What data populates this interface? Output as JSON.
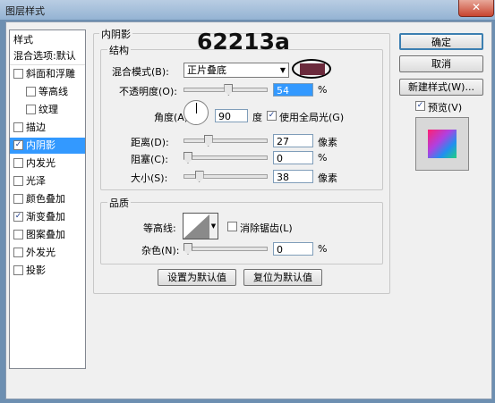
{
  "window": {
    "title": "图层样式",
    "close_glyph": "✕"
  },
  "overlay": {
    "watermark": "62213a"
  },
  "style_list": {
    "header": "样式",
    "blend_default": "混合选项:默认",
    "items": [
      {
        "label": "斜面和浮雕",
        "checked": false,
        "indent": false
      },
      {
        "label": "等高线",
        "checked": false,
        "indent": true
      },
      {
        "label": "纹理",
        "checked": false,
        "indent": true
      },
      {
        "label": "描边",
        "checked": false,
        "indent": false
      },
      {
        "label": "内阴影",
        "checked": true,
        "indent": false,
        "selected": true
      },
      {
        "label": "内发光",
        "checked": false,
        "indent": false
      },
      {
        "label": "光泽",
        "checked": false,
        "indent": false
      },
      {
        "label": "颜色叠加",
        "checked": false,
        "indent": false
      },
      {
        "label": "渐变叠加",
        "checked": true,
        "indent": false
      },
      {
        "label": "图案叠加",
        "checked": false,
        "indent": false
      },
      {
        "label": "外发光",
        "checked": false,
        "indent": false
      },
      {
        "label": "投影",
        "checked": false,
        "indent": false
      }
    ]
  },
  "panel": {
    "title": "内阴影",
    "structure": {
      "title": "结构",
      "blend_mode_label": "混合模式(B):",
      "blend_mode_value": "正片叠底",
      "swatch_color": "#6b2a3c",
      "opacity_label": "不透明度(O):",
      "opacity_value": "54",
      "opacity_fraction": 0.54,
      "angle_label": "角度(A):",
      "angle_value": "90",
      "angle_unit": "度",
      "global_light_label": "使用全局光(G)",
      "global_light_checked": true,
      "distance_label": "距离(D):",
      "distance_value": "27",
      "distance_fraction": 0.27,
      "choke_label": "阻塞(C):",
      "choke_value": "0",
      "choke_fraction": 0,
      "size_label": "大小(S):",
      "size_value": "38",
      "size_fraction": 0.15,
      "pixel_unit": "像素",
      "percent_unit": "%"
    },
    "quality": {
      "title": "品质",
      "contour_label": "等高线:",
      "anti_alias_label": "消除锯齿(L)",
      "noise_label": "杂色(N):",
      "noise_value": "0",
      "noise_fraction": 0,
      "percent_unit": "%"
    },
    "set_default": "设置为默认值",
    "reset_default": "复位为默认值"
  },
  "actions": {
    "ok": "确定",
    "cancel": "取消",
    "new_style": "新建样式(W)...",
    "preview_label": "预览(V)",
    "preview_checked": true
  }
}
